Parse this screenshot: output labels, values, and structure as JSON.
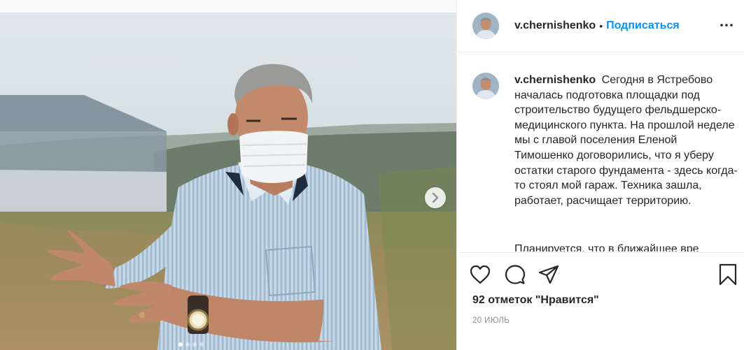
{
  "post": {
    "username": "v.chernishenko",
    "separator": "•",
    "follow_label": "Подписаться",
    "more_icon": "more-options-icon",
    "caption": {
      "username": "v.chernishenko",
      "text": "Сегодня в Ястребово началась подготовка площадки под строительство будущего фельдшерско-медицинского пункта. На прошлой неделе мы с главой поселения Еленой Тимошенко договорились, что я уберу остатки старого фундамента - здесь когда-то стоял мой гараж. Техника зашла, работает, расчищает территорию.",
      "next_line_partial": "Планируется, что в ближайшее вре"
    },
    "likes_text": "92 отметок \"Нравится\"",
    "date_text": "20 июль",
    "carousel": {
      "total_slides": 4,
      "active_slide": 1,
      "next_icon": "chevron-right-icon"
    },
    "actions": {
      "like_icon": "heart-icon",
      "comment_icon": "comment-icon",
      "share_icon": "share-icon",
      "save_icon": "bookmark-icon"
    },
    "colors": {
      "accent": "#0095f6",
      "text": "#262626",
      "muted": "#8e8e8e",
      "border": "#efefef"
    }
  }
}
